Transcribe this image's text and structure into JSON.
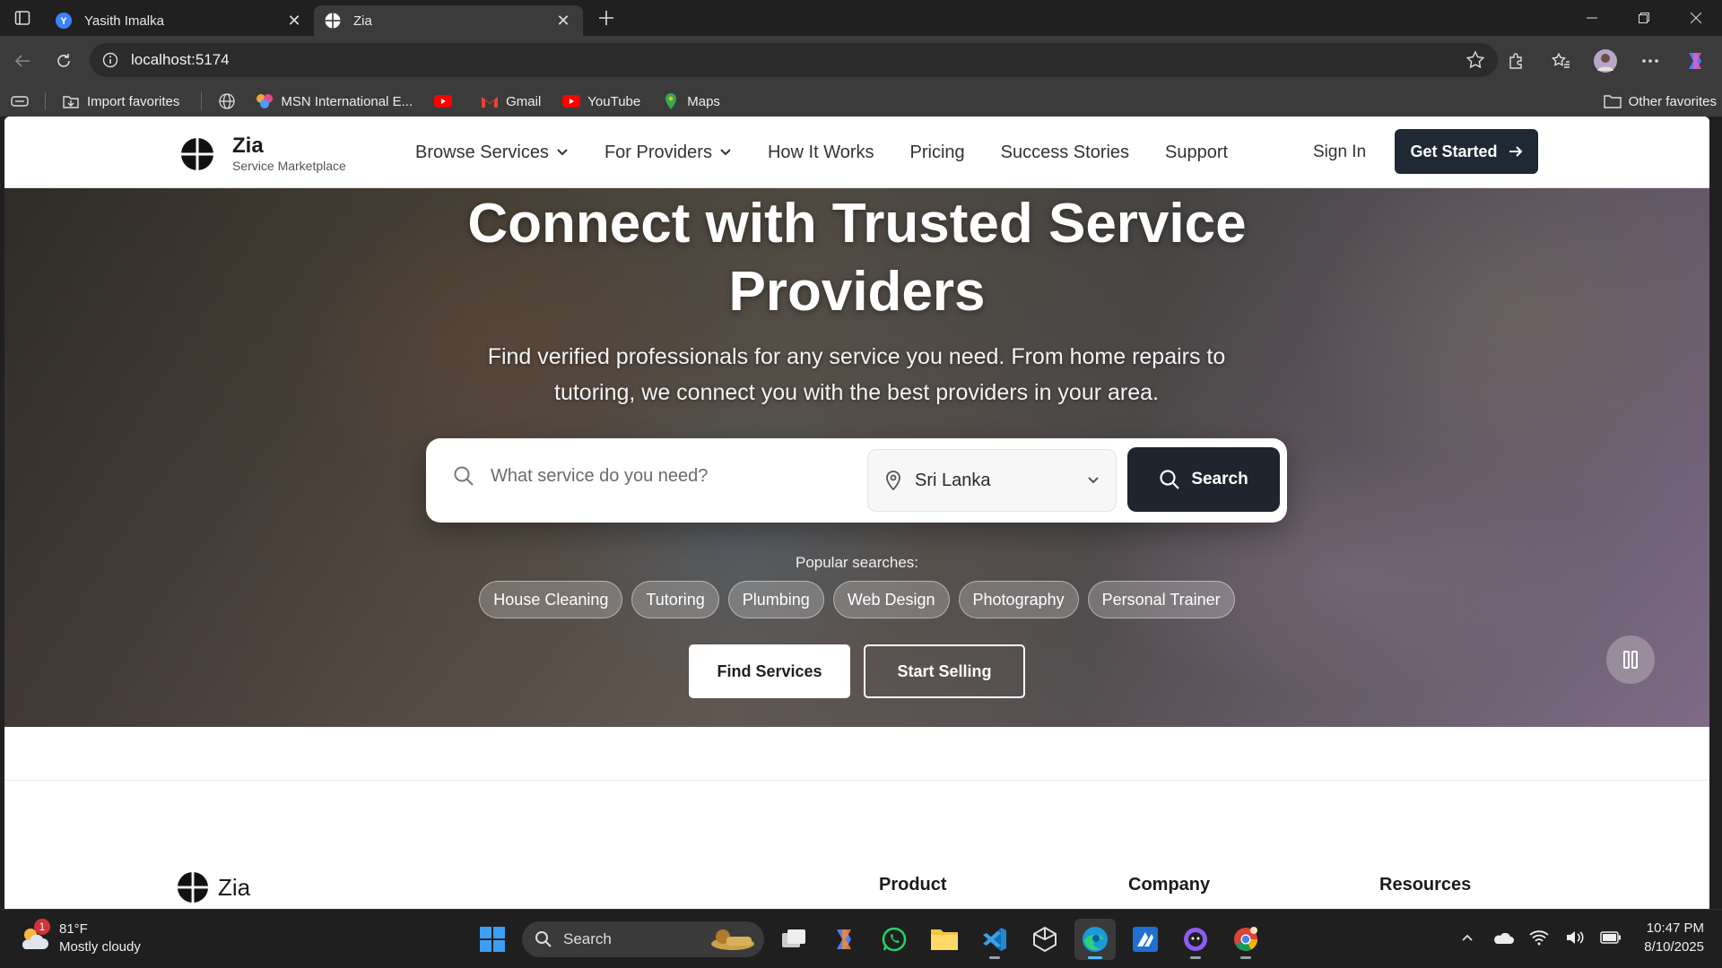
{
  "browser": {
    "tabs": [
      {
        "title": "Yasith Imalka",
        "active": false
      },
      {
        "title": "Zia",
        "active": true
      }
    ],
    "url": "localhost:5174",
    "favorites": [
      {
        "label": "Import favorites",
        "icon": "import-icon"
      },
      {
        "label": "MSN International E...",
        "icon": "msn-icon"
      },
      {
        "label": "",
        "icon": "youtube-icon"
      },
      {
        "label": "Gmail",
        "icon": "gmail-icon"
      },
      {
        "label": "YouTube",
        "icon": "youtube-icon"
      },
      {
        "label": "Maps",
        "icon": "maps-icon"
      }
    ],
    "other_favorites": "Other favorites"
  },
  "site": {
    "brand": "Zia",
    "tagline": "Service Marketplace",
    "nav": [
      {
        "label": "Browse Services",
        "dropdown": true
      },
      {
        "label": "For Providers",
        "dropdown": true
      },
      {
        "label": "How It Works",
        "dropdown": false
      },
      {
        "label": "Pricing",
        "dropdown": false
      },
      {
        "label": "Success Stories",
        "dropdown": false
      },
      {
        "label": "Support",
        "dropdown": false
      }
    ],
    "sign_in": "Sign In",
    "get_started": "Get Started"
  },
  "hero": {
    "title_line1": "Connect with Trusted Service",
    "title_line2": "Providers",
    "subtitle": "Find verified professionals for any service you need. From home repairs to tutoring, we connect you with the best providers in your area.",
    "search_placeholder": "What service do you need?",
    "location": "Sri Lanka",
    "search_button": "Search",
    "popular_label": "Popular searches:",
    "popular": [
      "House Cleaning",
      "Tutoring",
      "Plumbing",
      "Web Design",
      "Photography",
      "Personal Trainer"
    ],
    "find_services": "Find Services",
    "start_selling": "Start Selling"
  },
  "footer": {
    "brand": "Zia",
    "columns": [
      "Product",
      "Company",
      "Resources"
    ]
  },
  "taskbar": {
    "weather_temp": "81°F",
    "weather_desc": "Mostly cloudy",
    "weather_badge": "1",
    "search_label": "Search",
    "time": "10:47 PM",
    "date": "8/10/2025"
  }
}
